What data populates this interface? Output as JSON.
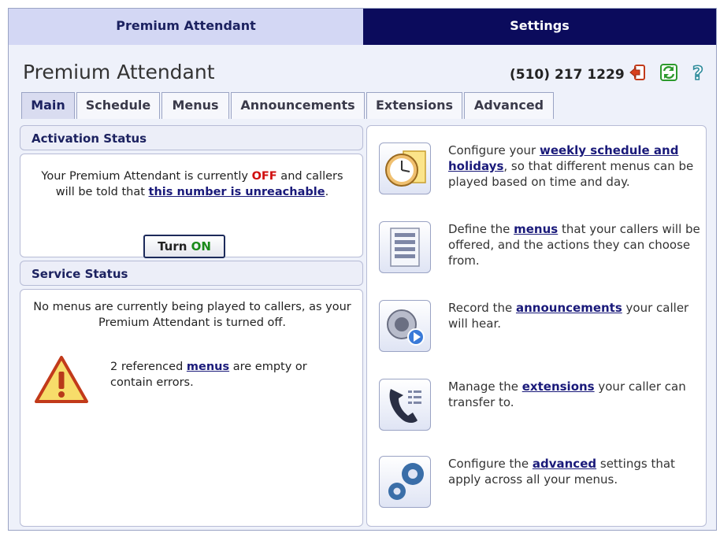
{
  "top_tabs": {
    "left": "Premium Attendant",
    "right": "Settings"
  },
  "header": {
    "title": "Premium Attendant",
    "phone": "(510) 217 1229"
  },
  "tabs": [
    {
      "label": "Main"
    },
    {
      "label": "Schedule"
    },
    {
      "label": "Menus"
    },
    {
      "label": "Announcements"
    },
    {
      "label": "Extensions"
    },
    {
      "label": "Advanced"
    }
  ],
  "activation": {
    "heading": "Activation Status",
    "text_1": "Your Premium Attendant is currently ",
    "off": "OFF",
    "text_2": " and callers will be told that ",
    "link": "this number is unreachable",
    "text_3": ".",
    "button_turn": "Turn ",
    "button_on": "ON"
  },
  "service": {
    "heading": "Service Status",
    "text": "No menus are currently being played to callers, as your Premium Attendant is turned off.",
    "warn_1": "2 referenced ",
    "warn_link": "menus",
    "warn_2": " are empty or contain errors."
  },
  "features": [
    {
      "pre": "Configure your ",
      "link": "weekly schedule and holidays",
      "post": ", so that different menus can be played based on time and day."
    },
    {
      "pre": "Define the ",
      "link": "menus",
      "post": " that your callers will be offered, and the actions they can choose from."
    },
    {
      "pre": "Record the ",
      "link": "announcements",
      "post": " your caller will hear."
    },
    {
      "pre": "Manage the ",
      "link": "extensions",
      "post": " your caller can transfer to."
    },
    {
      "pre": "Configure the ",
      "link": "advanced",
      "post": " settings that apply across all your menus."
    }
  ]
}
